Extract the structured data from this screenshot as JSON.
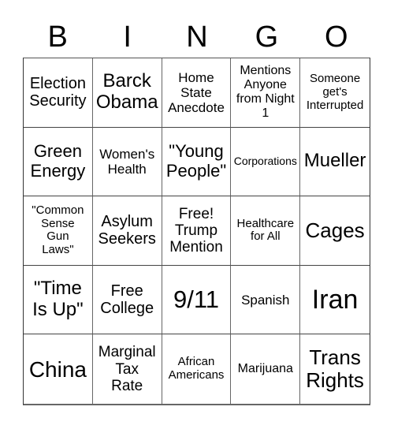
{
  "header": {
    "letters": [
      "B",
      "I",
      "N",
      "G",
      "O"
    ]
  },
  "board": {
    "rows": [
      [
        "Election\nSecurity",
        "Barck\nObama",
        "Home\nState\nAnecdote",
        "Mentions\nAnyone\nfrom Night\n1",
        "Someone\nget's\nInterrupted"
      ],
      [
        "Green\nEnergy",
        "Women's\nHealth",
        "\"Young\nPeople\"",
        "Corporations",
        "Mueller"
      ],
      [
        "\"Common\nSense\nGun\nLaws\"",
        "Asylum\nSeekers",
        "Free!\nTrump\nMention",
        "Healthcare\nfor All",
        "Cages"
      ],
      [
        "\"Time\nIs Up\"",
        "Free\nCollege",
        "9/11",
        "Spanish",
        "Iran"
      ],
      [
        "China",
        "Marginal\nTax\nRate",
        "African\nAmericans",
        "Marijuana",
        "Trans\nRights"
      ]
    ]
  }
}
